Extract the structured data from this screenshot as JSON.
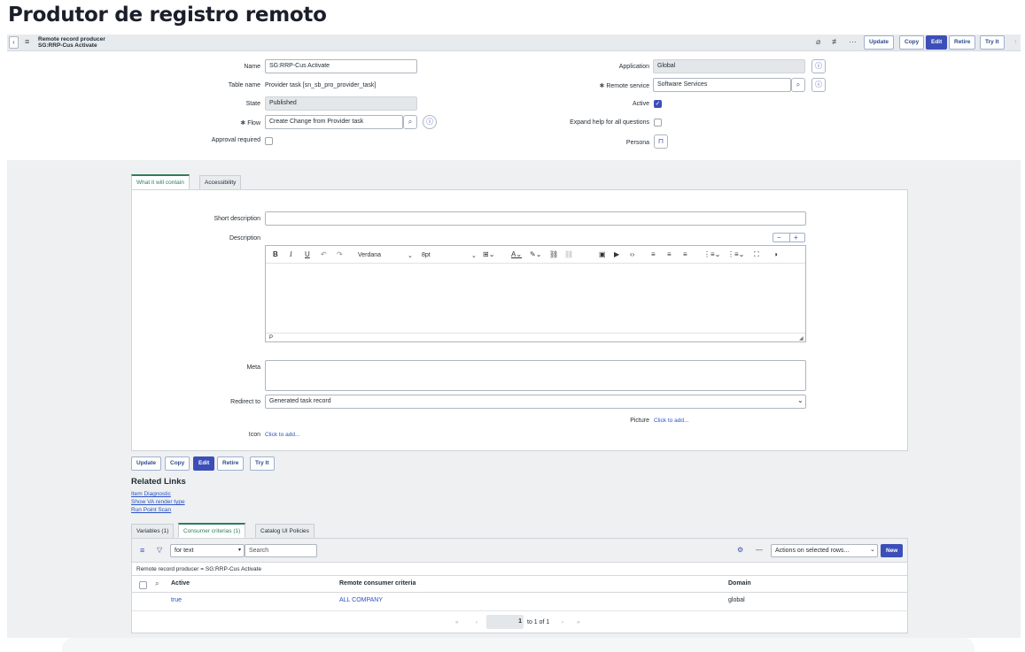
{
  "page_heading": "Produtor de registro remoto",
  "header": {
    "title_line1": "Remote record producer",
    "title_line2": "SG:RRP-Cus Activate",
    "buttons": [
      "Update",
      "Copy",
      "Edit",
      "Retire",
      "Try It"
    ]
  },
  "form": {
    "name_label": "Name",
    "name_value": "SG:RRP-Cus Activate",
    "table_name_label": "Table name",
    "table_name_value": "Provider task [sn_sb_pro_provider_task]",
    "state_label": "State",
    "state_value": "Published",
    "flow_label": "Flow",
    "flow_value": "Create Change from Provider task",
    "approval_label": "Approval required",
    "application_label": "Application",
    "application_value": "Global",
    "remote_service_label": "Remote service",
    "remote_service_value": "Software Services",
    "active_label": "Active",
    "expand_help_label": "Expand help for all questions",
    "persona_label": "Persona"
  },
  "section_tabs": [
    "What it will contain",
    "Accessibility"
  ],
  "contain": {
    "short_description_label": "Short description",
    "description_label": "Description",
    "font_name": "Verdana",
    "font_size": "8pt",
    "status_path": "P",
    "meta_label": "Meta",
    "redirect_label": "Redirect to",
    "redirect_value": "Generated task record",
    "picture_label": "Picture",
    "picture_link": "Click to add...",
    "icon_label": "Icon",
    "icon_link": "Click to add..."
  },
  "bottom_buttons": [
    "Update",
    "Copy",
    "Edit",
    "Retire",
    "Try It"
  ],
  "related": {
    "title": "Related Links",
    "links": [
      "Item Diagnostic",
      "Show VA render type",
      "Run Point Scan"
    ]
  },
  "list_tabs": [
    "Variables (1)",
    "Consumer criterias (1)",
    "Catalog UI Policies"
  ],
  "list": {
    "filter_select": "for text",
    "search_placeholder": "Search",
    "actions_select": "Actions on selected rows...",
    "new_label": "New",
    "breadcrumb": "Remote record producer = SG:RRP-Cus Activate",
    "columns": [
      "Active",
      "Remote consumer criteria",
      "Domain"
    ],
    "rows": [
      {
        "active": "true",
        "criteria": "ALL COMPANY",
        "domain": "global"
      }
    ],
    "pager_current": "1",
    "pager_text": "to 1 of 1"
  },
  "colors": {
    "primary": "#3c4fb8",
    "tab_active": "#2f7d5b",
    "link": "#2952c4"
  }
}
